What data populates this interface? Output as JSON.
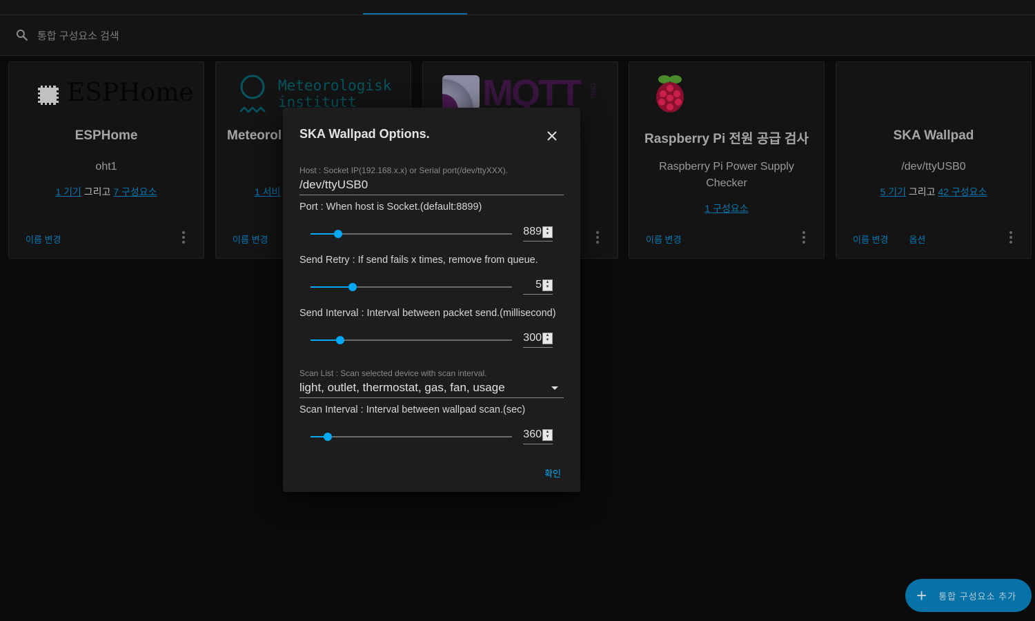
{
  "search": {
    "placeholder": "통합 구성요소 검색"
  },
  "cards": [
    {
      "logo": "ESPHome",
      "title": "ESPHome",
      "subtitle": "oht1",
      "devices": "1 기기",
      "and": "그리고",
      "entities": "7 구성요소",
      "rename": "이름 변경"
    },
    {
      "logo_line1": "Meteorologisk",
      "logo_line2": "institutt",
      "title": "Meteorol",
      "services": "1 서비",
      "rename": "이름 변경"
    },
    {
      "logo": "MQTT",
      "logo_suffix": "ORG"
    },
    {
      "title": "Raspberry Pi 전원 공급 검사",
      "subtitle": "Raspberry Pi Power Supply Checker",
      "entities": "1 구성요소",
      "rename": "이름 변경"
    },
    {
      "title": "SKA Wallpad",
      "subtitle": "/dev/ttyUSB0",
      "devices": "5 기기",
      "and": "그리고",
      "entities": "42 구성요소",
      "rename": "이름 변경",
      "options": "옵션"
    }
  ],
  "dialog": {
    "title": "SKA Wallpad Options.",
    "host": {
      "label": "Host : Socket IP(192.168.x.x) or Serial port(/dev/ttyXXX).",
      "value": "/dev/ttyUSB0"
    },
    "port": {
      "label": "Port : When host is Socket.(default:8899)",
      "value": "889",
      "fraction": 0.137
    },
    "retry": {
      "label": "Send Retry : If send fails x times, remove from queue.",
      "value": "5",
      "fraction": 0.21
    },
    "interval": {
      "label": "Send Interval : Interval between packet send.(millisecond)",
      "value": "300",
      "fraction": 0.147
    },
    "scan_list": {
      "label": "Scan List : Scan selected device with scan interval.",
      "value": "light, outlet, thermostat, gas, fan, usage"
    },
    "scan_interval": {
      "label": "Scan Interval : Interval between wallpad scan.(sec)",
      "value": "360",
      "fraction": 0.086
    },
    "ok": "확인"
  },
  "fab": {
    "label": "통합 구성요소 추가"
  },
  "colors": {
    "accent": "#03a9f4",
    "fab": "#0772a8"
  }
}
